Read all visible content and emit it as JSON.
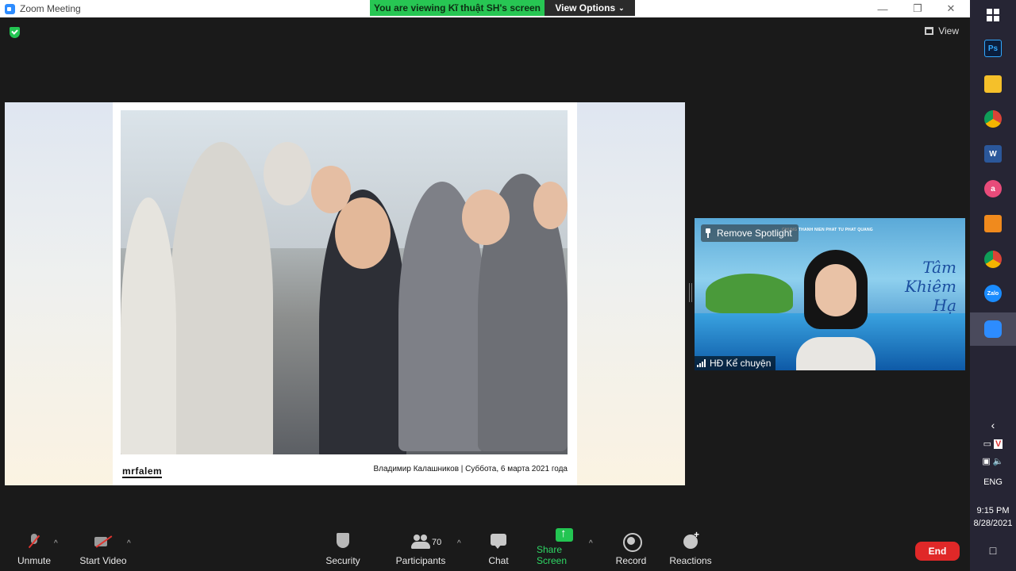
{
  "window": {
    "title": "Zoom Meeting",
    "viewing_banner": "You are viewing Kĩ thuật SH's screen",
    "view_options_label": "View Options",
    "view_label": "View"
  },
  "shared_screen": {
    "logo_text": "mrfalem",
    "caption": "Владимир Калашников | Суббота, 6 марта 2021 года"
  },
  "spotlight_video": {
    "remove_spotlight_label": "Remove Spotlight",
    "participant_name": "HĐ Kể chuyện",
    "headline_text": "CHUNG THANH NIEN PHAT TU PHAT QUANG",
    "background_script": "Tâm\nKhiêm Hạ"
  },
  "toolbar": {
    "unmute_label": "Unmute",
    "start_video_label": "Start Video",
    "security_label": "Security",
    "participants_label": "Participants",
    "participants_count": "70",
    "chat_label": "Chat",
    "share_screen_label": "Share Screen",
    "record_label": "Record",
    "reactions_label": "Reactions",
    "end_label": "End"
  },
  "taskbar": {
    "icons": [
      "windows-start",
      "photoshop",
      "file-explorer",
      "chrome",
      "word",
      "app-pink",
      "app-orange",
      "chrome-alt",
      "zalo",
      "zoom"
    ],
    "language": "ENG",
    "time": "9:15 PM",
    "date": "8/28/2021"
  },
  "colors": {
    "accent_green": "#27c653",
    "end_red": "#e02828",
    "toolbar_bg": "#1a1a1a"
  }
}
